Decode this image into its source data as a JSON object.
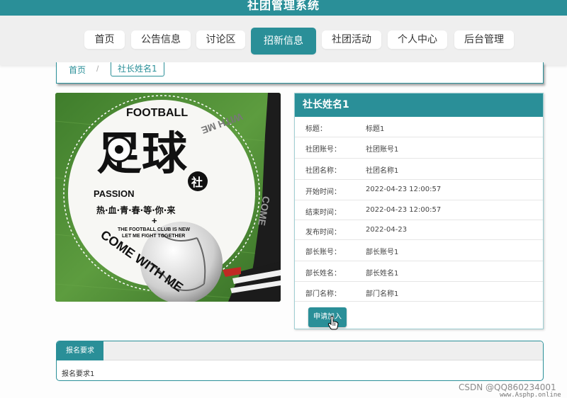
{
  "app": {
    "title": "社团管理系统"
  },
  "nav": {
    "items": [
      {
        "label": "首页"
      },
      {
        "label": "公告信息"
      },
      {
        "label": "讨论区"
      },
      {
        "label": "招新信息",
        "active": true
      },
      {
        "label": "社团活动"
      },
      {
        "label": "个人中心"
      },
      {
        "label": "后台管理"
      }
    ]
  },
  "breadcrumb": {
    "home": "首页",
    "separator": "/",
    "current": "社长姓名1"
  },
  "poster": {
    "title_en": "FOOTBALL",
    "title_cn": "足球",
    "badge": "社",
    "passion": "PASSION",
    "slogan": "热·血·青·春·等·你·来",
    "plus": "+",
    "club_line1": "THE FOOTBALL CLUB IS NEW",
    "club_line2": "LET ME FIGHT TOGETHER",
    "ring_text_top": "WITH ME",
    "ring_text_right": "COME",
    "ring_text_bottom": "COME WITH ME"
  },
  "detail": {
    "heading": "社长姓名1",
    "fields": [
      {
        "label": "标题：",
        "value": "标题1"
      },
      {
        "label": "社团账号：",
        "value": "社团账号1"
      },
      {
        "label": "社团名称：",
        "value": "社团名称1"
      },
      {
        "label": "开始时间：",
        "value": "2022-04-23 12:00:57"
      },
      {
        "label": "结束时间：",
        "value": "2022-04-23 12:00:57"
      },
      {
        "label": "发布时间：",
        "value": "2022-04-23"
      },
      {
        "label": "部长账号：",
        "value": "部长账号1"
      },
      {
        "label": "部长姓名：",
        "value": "部长姓名1"
      },
      {
        "label": "部门名称：",
        "value": "部门名称1"
      }
    ],
    "apply_label": "申请加入"
  },
  "requirements": {
    "tab_label": "报名要求",
    "content": "报名要求1"
  },
  "watermark": {
    "text": "CSDN @QQ860234001",
    "site": "www.Asphp.online"
  },
  "colors": {
    "primary": "#2a8f98",
    "nav_bg": "#efefef",
    "grass": "#4e8f37"
  }
}
